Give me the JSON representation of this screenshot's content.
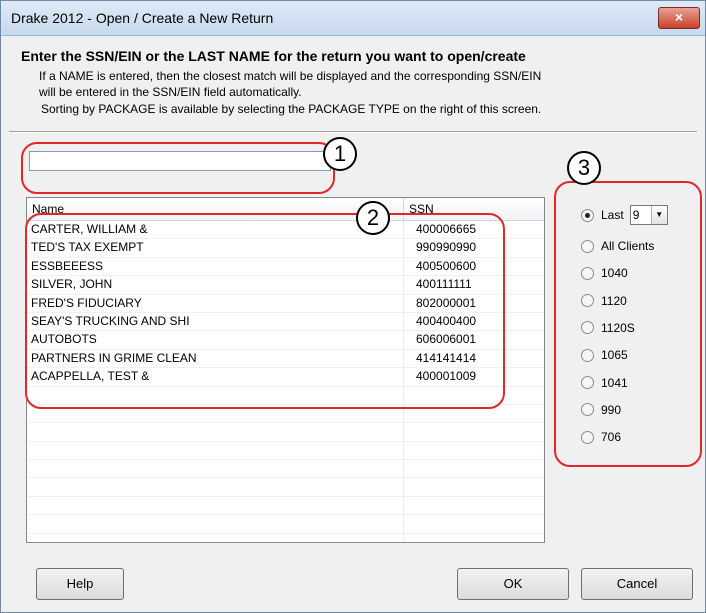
{
  "window": {
    "title": "Drake 2012 - Open / Create a New Return",
    "close_glyph": "×"
  },
  "instructions": {
    "heading": "Enter the SSN/EIN or the LAST NAME for the return you want to open/create",
    "line1": "If a NAME is entered, then the closest match will be displayed and the corresponding SSN/EIN",
    "line2": "will be entered in the SSN/EIN field automatically.",
    "line3": "Sorting by PACKAGE is available by selecting the PACKAGE TYPE on the right of this screen."
  },
  "search": {
    "value": "",
    "placeholder": ""
  },
  "list": {
    "columns": {
      "name": "Name",
      "ssn": "SSN"
    },
    "rows": [
      {
        "name": "CARTER, WILLIAM &",
        "ssn": "400006665"
      },
      {
        "name": "TED'S TAX EXEMPT",
        "ssn": "990990990"
      },
      {
        "name": "ESSBEEESS",
        "ssn": "400500600"
      },
      {
        "name": "SILVER, JOHN",
        "ssn": "400111111"
      },
      {
        "name": "FRED'S FIDUCIARY",
        "ssn": "802000001"
      },
      {
        "name": "SEAY'S TRUCKING AND SHI",
        "ssn": "400400400"
      },
      {
        "name": "AUTOBOTS",
        "ssn": "606006001"
      },
      {
        "name": "PARTNERS IN GRIME CLEAN",
        "ssn": "414141414"
      },
      {
        "name": "ACAPPELLA, TEST &",
        "ssn": "400001009"
      }
    ]
  },
  "package_filter": {
    "last_label": "Last",
    "last_count": "9",
    "options": [
      "All Clients",
      "1040",
      "1120",
      "1120S",
      "1065",
      "1041",
      "990",
      "706"
    ],
    "selected": "Last"
  },
  "buttons": {
    "help": "Help",
    "ok": "OK",
    "cancel": "Cancel"
  },
  "callouts": {
    "one": "1",
    "two": "2",
    "three": "3"
  },
  "colors": {
    "callout": "#e0282b",
    "close": "#c8412c"
  }
}
